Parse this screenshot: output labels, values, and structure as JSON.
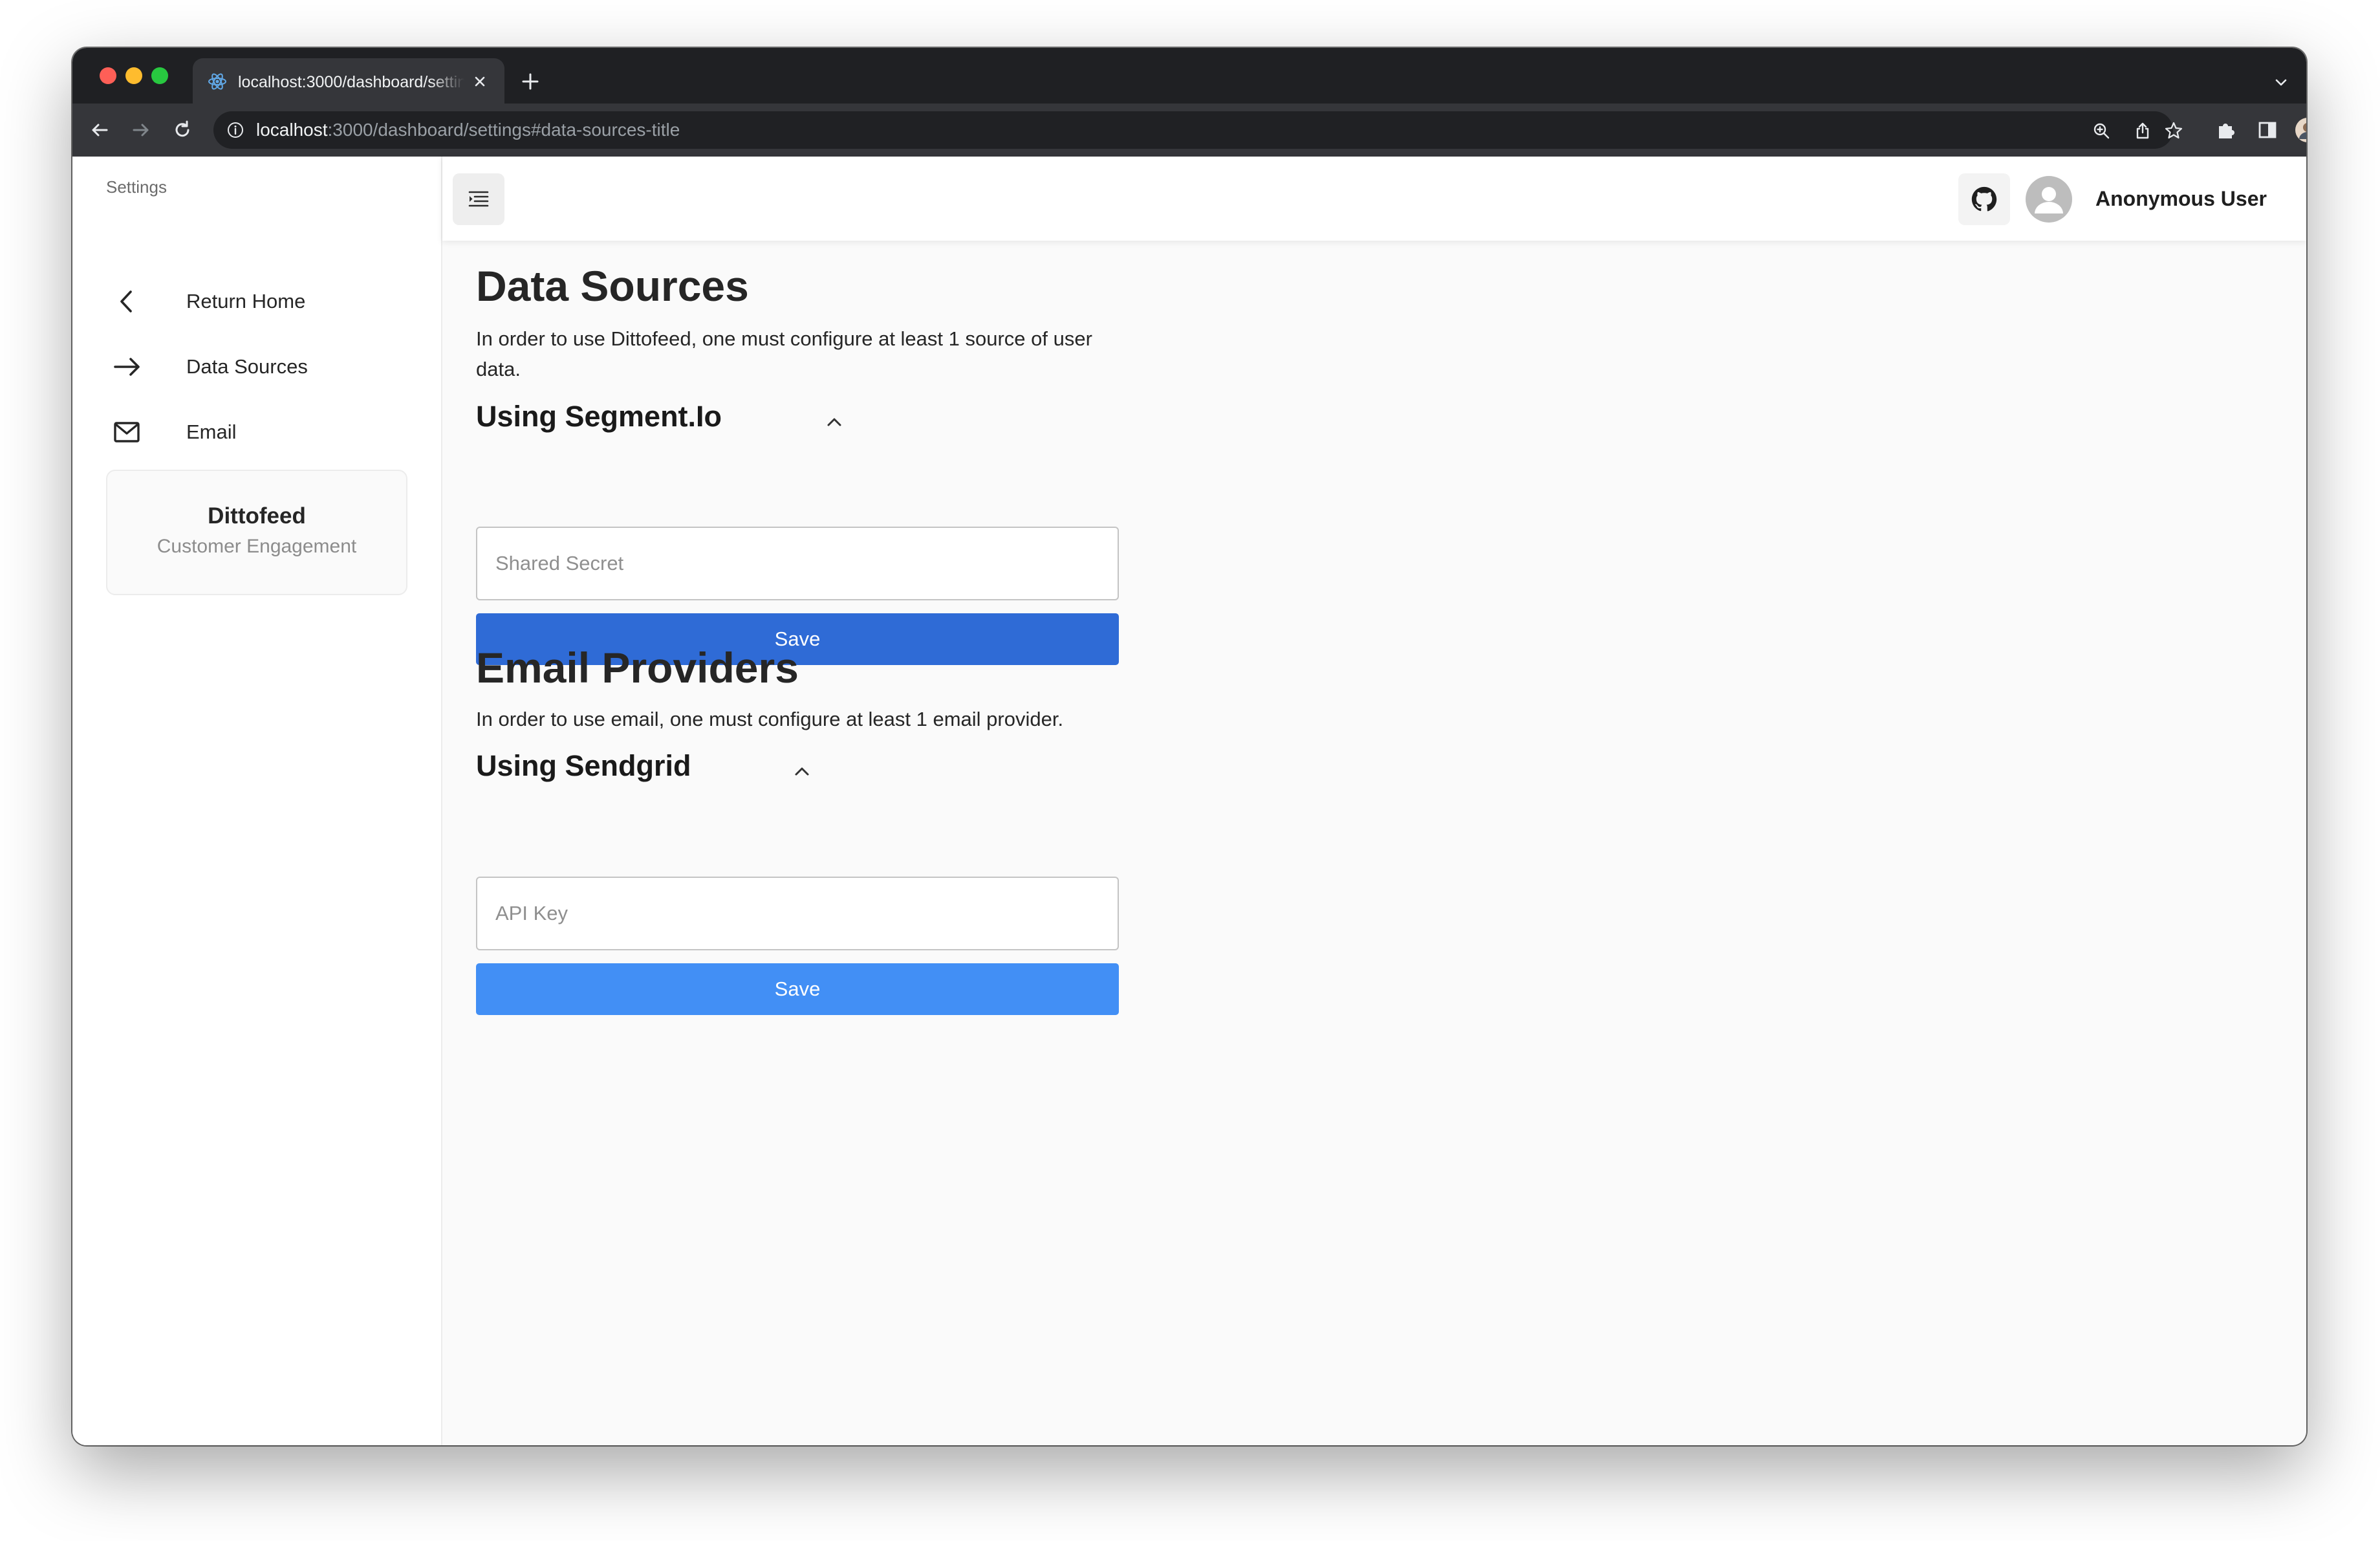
{
  "browser": {
    "tab_title": "localhost:3000/dashboard/settings",
    "url_host": "localhost",
    "url_path": ":3000/dashboard/settings#data-sources-title"
  },
  "sidebar": {
    "heading": "Settings",
    "items": [
      {
        "label": "Return Home",
        "icon": "chevron-left-icon"
      },
      {
        "label": "Data Sources",
        "icon": "arrow-right-icon"
      },
      {
        "label": "Email",
        "icon": "mail-icon"
      }
    ],
    "brand": {
      "name": "Dittofeed",
      "subtitle": "Customer Engagement"
    }
  },
  "header": {
    "user_name": "Anonymous User"
  },
  "main": {
    "data_sources": {
      "title": "Data Sources",
      "description": "In order to use Dittofeed, one must configure at least 1 source of user data.",
      "segment": {
        "title": "Using Segment.Io",
        "placeholder": "Shared Secret",
        "value": "",
        "save_label": "Save",
        "button_color": "#2f6bd6"
      }
    },
    "email_providers": {
      "title": "Email Providers",
      "description": "In order to use email, one must configure at least 1 email provider.",
      "sendgrid": {
        "title": "Using Sendgrid",
        "placeholder": "API Key",
        "value": "",
        "save_label": "Save",
        "button_color": "#428ff5"
      }
    }
  }
}
